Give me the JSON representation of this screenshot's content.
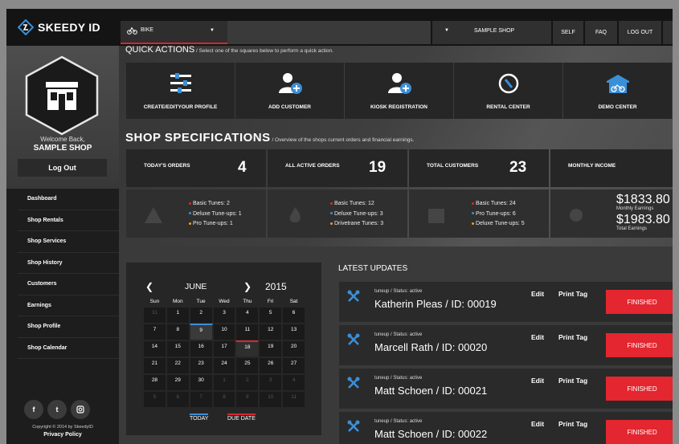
{
  "brand": {
    "name": "SKEEDY ID"
  },
  "colors": {
    "accent_red": "#e3262f",
    "accent_blue": "#3b8fd8",
    "background": "#2b2b2b"
  },
  "profile": {
    "welcome": "Welcome Back,",
    "shop": "SAMPLE SHOP",
    "logout": "Log Out"
  },
  "sidebar": {
    "items": [
      {
        "label": "Dashboard"
      },
      {
        "label": "Shop Rentals"
      },
      {
        "label": "Shop Services"
      },
      {
        "label": "Shop History"
      },
      {
        "label": "Customers"
      },
      {
        "label": "Earnings"
      },
      {
        "label": "Shop Profile"
      },
      {
        "label": "Shop Calendar"
      }
    ],
    "social": [
      "f",
      "t",
      "instagram-icon"
    ],
    "copyright": "Copyright © 2014 by SkeedyID",
    "privacy": "Privacy Policy"
  },
  "topbar": {
    "bike": "BIKE",
    "shop": "SAMPLE SHOP",
    "self": "SELF",
    "faq": "FAQ",
    "logout": "LOG OUT"
  },
  "quick_actions": {
    "title": "QUICK ACTIONS",
    "subtitle": " / Select one of the squares below to perform a quick action.",
    "items": [
      {
        "label": "CREATE/EDITYOUR PROFILE",
        "icon": "sliders-icon"
      },
      {
        "label": "ADD CUSTOMER",
        "icon": "add-user-icon"
      },
      {
        "label": "KIOSK REGISTRATION",
        "icon": "add-user-icon"
      },
      {
        "label": "RENTAL CENTER",
        "icon": "compass-icon"
      },
      {
        "label": "DEMO CENTER",
        "icon": "bike-shop-icon"
      }
    ]
  },
  "shop_specs": {
    "title": "SHOP SPECIFICATIONS",
    "subtitle": " / Overview of the shops current orders and financial earnings.",
    "todays_orders": {
      "title": "TODAY'S ORDERS",
      "value": "4",
      "items": [
        {
          "label": "Basic Tunes: 2",
          "color": "#e3262f"
        },
        {
          "label": "Deluxe Tune-ups: 1",
          "color": "#3b8fd8"
        },
        {
          "label": "Pro Tune-ups: 1",
          "color": "#e8a020"
        }
      ]
    },
    "active_orders": {
      "title": "ALL ACTIVE ORDERS",
      "value": "19",
      "items": [
        {
          "label": "Basic Tunes: 12",
          "color": "#e3262f"
        },
        {
          "label": "Deluxe Tune-ups: 3",
          "color": "#3b8fd8"
        },
        {
          "label": "Drivetrane Tunes: 3",
          "color": "#e8a020"
        }
      ]
    },
    "total_customers": {
      "title": "TOTAL CUSTOMERS",
      "value": "23",
      "items": [
        {
          "label": "Basic Tunes: 24",
          "color": "#e3262f"
        },
        {
          "label": "Pro Tune-ups: 6",
          "color": "#3b8fd8"
        },
        {
          "label": "Deluxe Tune-ups: 5",
          "color": "#e8a020"
        }
      ]
    },
    "monthly_income": {
      "title": "MONTHLY INCOME",
      "monthly_value": "$1833.80",
      "monthly_label": "Monthly Earnings",
      "total_value": "$1983.80",
      "total_label": "Total Earnings"
    }
  },
  "calendar": {
    "month": "JUNE",
    "year": "2015",
    "days": [
      "Sun",
      "Mon",
      "Tue",
      "Wed",
      "Thu",
      "Fri",
      "Sat"
    ],
    "weeks": [
      [
        "31",
        "1",
        "2",
        "3",
        "4",
        "5",
        "6"
      ],
      [
        "7",
        "8",
        "9",
        "10",
        "11",
        "12",
        "13"
      ],
      [
        "14",
        "15",
        "16",
        "17",
        "18",
        "19",
        "20"
      ],
      [
        "21",
        "22",
        "23",
        "24",
        "25",
        "26",
        "27"
      ],
      [
        "28",
        "29",
        "30",
        "1",
        "2",
        "3",
        "4"
      ],
      [
        "5",
        "6",
        "7",
        "8",
        "9",
        "10",
        "11"
      ]
    ],
    "legend_today": "TODAY",
    "legend_due": "DUE DATE"
  },
  "updates": {
    "title": "LATEST UPDATES",
    "items": [
      {
        "status": "tuneup / Status: active",
        "name": "Katherin Pleas / ID: 00019",
        "edit": "Edit",
        "print": "Print Tag",
        "button": "FINISHED"
      },
      {
        "status": "tuneup / Status: active",
        "name": "Marcell Rath / ID: 00020",
        "edit": "Edit",
        "print": "Print Tag",
        "button": "FINISHED"
      },
      {
        "status": "tuneup / Status: active",
        "name": "Matt Schoen / ID: 00021",
        "edit": "Edit",
        "print": "Print Tag",
        "button": "FINISHED"
      },
      {
        "status": "tuneup / Status: active",
        "name": "Matt Schoen / ID: 00022",
        "edit": "Edit",
        "print": "Print Tag",
        "button": "FINISHED"
      }
    ]
  }
}
